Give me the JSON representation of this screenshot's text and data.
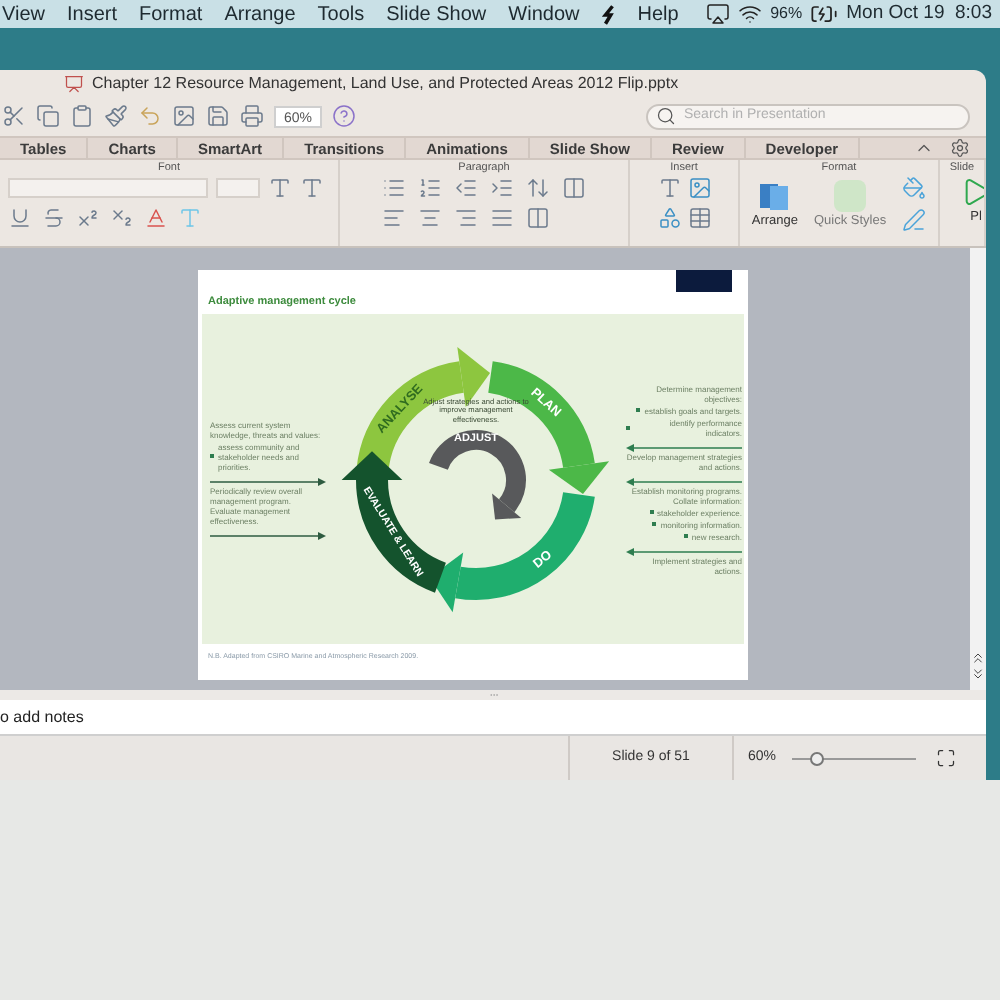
{
  "menu_bar": {
    "items": [
      "View",
      "Insert",
      "Format",
      "Arrange",
      "Tools",
      "Slide Show",
      "Window",
      "Help"
    ],
    "battery": "96%",
    "clock": "Mon Oct 19  8:03"
  },
  "window": {
    "title": "Chapter 12 Resource Management, Land Use, and Protected Areas 2012 Flip.pptx"
  },
  "toolbar": {
    "zoom": "60%",
    "search_placeholder": "Search in Presentation"
  },
  "ribbon_tabs": [
    "Tables",
    "Charts",
    "SmartArt",
    "Transitions",
    "Animations",
    "Slide Show",
    "Review",
    "Developer"
  ],
  "ribbon_groups": [
    "Font",
    "Paragraph",
    "Insert",
    "Format",
    "Slide"
  ],
  "ribbon_buttons": [
    "Arrange",
    "Quick Styles",
    "Pl"
  ],
  "slide": {
    "title": "Adaptive management cycle",
    "stages": [
      {
        "label": "ANALYSE",
        "kind": "analyse"
      },
      {
        "label": "PLAN",
        "kind": "plan"
      },
      {
        "label": "DO",
        "kind": "do"
      },
      {
        "label": "EVALUATE & LEARN",
        "kind": "evaluate"
      },
      {
        "label": "ADJUST",
        "kind": "adjust"
      }
    ],
    "center_text": "Adjust strategies and actions to improve management effectiveness.",
    "left_notes": [
      {
        "text": "Assess current system knowledge, threats and values:",
        "bullets": [
          "assess community and stakeholder needs and priorities."
        ],
        "arrow": true
      },
      {
        "text": "Periodically review overall management program."
      },
      {
        "text": "Evaluate management effectiveness.",
        "arrow": true
      }
    ],
    "right_notes": [
      {
        "text": "Determine management objectives:",
        "bullets": [
          "establish goals and targets.",
          "identify performance indicators."
        ],
        "arrow": true
      },
      {
        "text": "Develop management strategies and actions.",
        "arrow": true
      },
      {
        "text": "Establish monitoring programs."
      },
      {
        "text": "Collate information:",
        "bullets": [
          "stakeholder experience.",
          "monitoring information.",
          "new research."
        ],
        "arrow": true
      },
      {
        "text": "Implement strategies and actions."
      }
    ],
    "footnote": "N.B. Adapted from CSIRO Marine and Atmospheric Research 2009."
  },
  "notes": {
    "placeholder": "o add notes"
  },
  "status_bar": {
    "slide": "Slide 9 of 51",
    "zoom": "60%",
    "zoom_slider": {
      "level": 0.2
    }
  }
}
